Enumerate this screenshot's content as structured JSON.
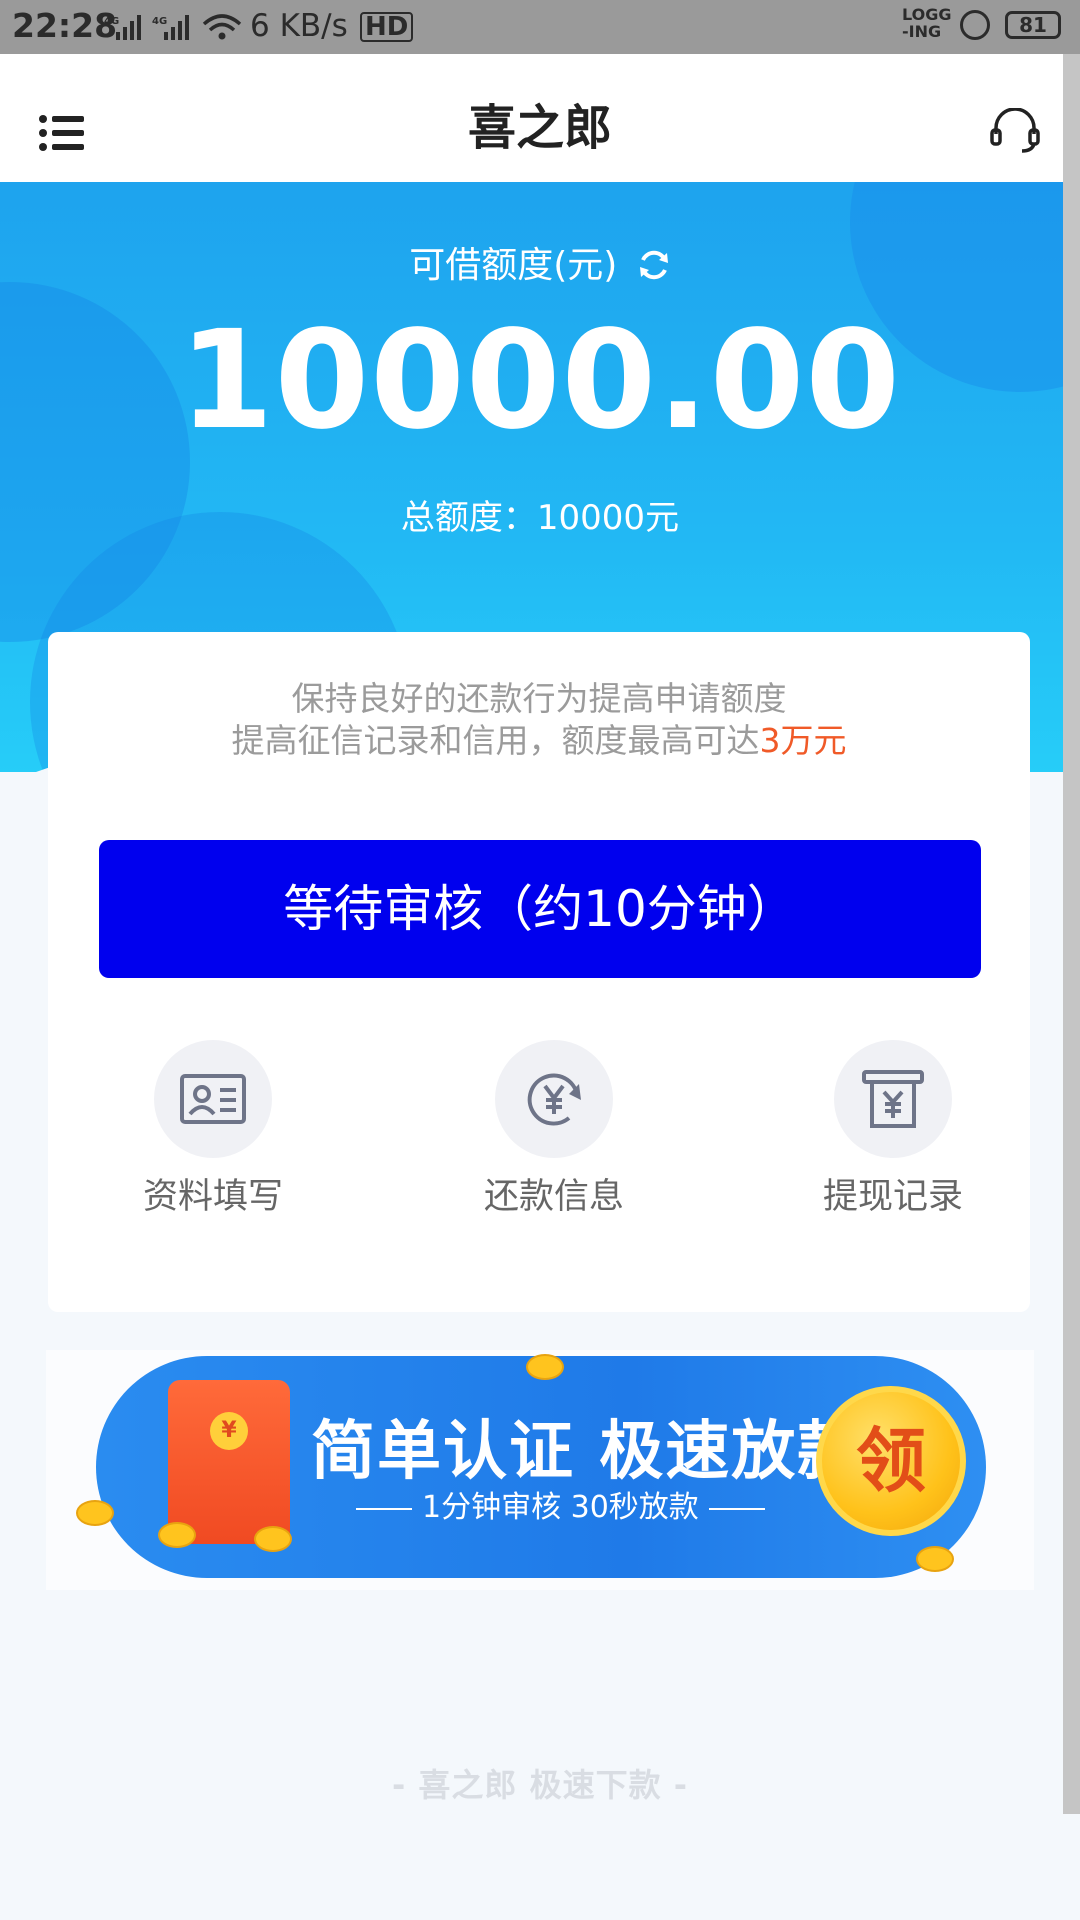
{
  "status_bar": {
    "time": "22:28",
    "network_1": "4G",
    "network_2": "4G",
    "speed": "6 KB/s",
    "hd": "HD",
    "logging": "LOGG\n-ING",
    "battery": "81"
  },
  "header": {
    "title": "喜之郎",
    "menu_icon": "menu-list-icon",
    "support_icon": "headset-icon"
  },
  "hero": {
    "label": "可借额度(元)",
    "amount": "10000.00",
    "total": "总额度：10000元"
  },
  "card": {
    "tip_line1": "保持良好的还款行为提高申请额度",
    "tip_line2_prefix": "提高征信记录和信用，额度最高可达",
    "tip_line2_highlight": "3万元",
    "button_label": "等待审核（约10分钟）",
    "features": [
      {
        "label": "资料填写",
        "icon": "id-card-icon"
      },
      {
        "label": "还款信息",
        "icon": "yen-cycle-icon"
      },
      {
        "label": "提现记录",
        "icon": "yen-receipt-icon"
      }
    ]
  },
  "banner": {
    "title": "简单认证  极速放款",
    "subtitle": "1分钟审核 30秒放款",
    "coin_text": "领",
    "seal_text": "¥"
  },
  "footer": {
    "text": "- 喜之郎   极速下款 -"
  },
  "colors": {
    "primary_button": "#0000ee",
    "hero_blue": "#1ea3ee",
    "highlight": "#f05a28"
  }
}
